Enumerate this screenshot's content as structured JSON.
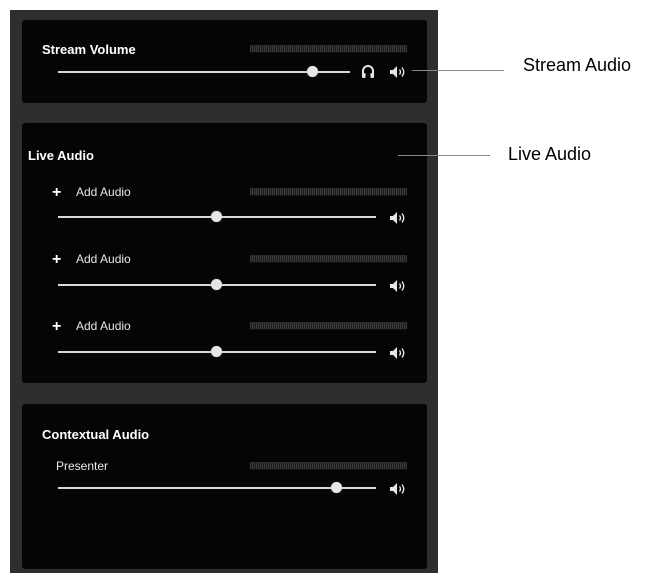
{
  "stream_panel": {
    "title": "Stream Volume",
    "slider_level": 0.8,
    "icons": [
      "headphones-icon",
      "speaker-icon"
    ]
  },
  "live_panel": {
    "title": "Live Audio",
    "channels": [
      {
        "label": "Add Audio",
        "slider_level": 0.5
      },
      {
        "label": "Add Audio",
        "slider_level": 0.5
      },
      {
        "label": "Add Audio",
        "slider_level": 0.5
      }
    ]
  },
  "contextual_panel": {
    "title": "Contextual Audio",
    "channel": {
      "label": "Presenter",
      "slider_level": 0.88
    }
  },
  "callouts": {
    "stream_audio": "Stream Audio",
    "live_audio": "Live Audio"
  },
  "colors": {
    "frame": "#2e2e2e",
    "panel": "#050505",
    "slider": "#d9d9d9"
  }
}
